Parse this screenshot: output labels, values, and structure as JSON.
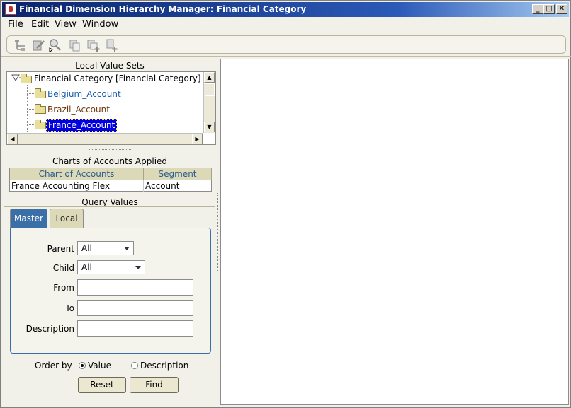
{
  "window": {
    "title": "Financial Dimension Hierarchy Manager: Financial Category",
    "minimize": "_",
    "maximize": "□",
    "close": "✕"
  },
  "menu": [
    {
      "label": "File"
    },
    {
      "label": "Edit"
    },
    {
      "label": "View"
    },
    {
      "label": "Window"
    }
  ],
  "toolbar": {
    "icons": [
      "hierarchy-icon",
      "edit-icon",
      "search-icon",
      "copy-icon",
      "add-child-icon",
      "add-sibling-icon"
    ]
  },
  "local_value_sets": {
    "heading": "Local Value Sets",
    "root": "Financial Category  [Financial Category]",
    "items": [
      "Belgium_Account",
      "Brazil_Account",
      "France_Account"
    ],
    "selected": "France_Account",
    "colors": {
      "link": "#1a5fae",
      "normal": "#6b3a10",
      "selected_bg": "#0000e0"
    }
  },
  "charts_of_accounts": {
    "heading": "Charts of Accounts Applied",
    "columns": [
      "Chart of Accounts",
      "Segment"
    ],
    "rows": [
      [
        "France Accounting Flex",
        "Account"
      ]
    ]
  },
  "query_values": {
    "heading": "Query Values",
    "tabs": [
      "Master",
      "Local"
    ],
    "active_tab": "Master",
    "parent_label": "Parent",
    "parent_value": "All",
    "child_label": "Child",
    "child_value": "All",
    "from_label": "From",
    "from_value": "",
    "to_label": "To",
    "to_value": "",
    "description_label": "Description",
    "description_value": "",
    "order_by_label": "Order by",
    "order_options": [
      "Value",
      "Description"
    ],
    "order_selected": "Value",
    "reset_label": "Reset",
    "find_label": "Find"
  }
}
